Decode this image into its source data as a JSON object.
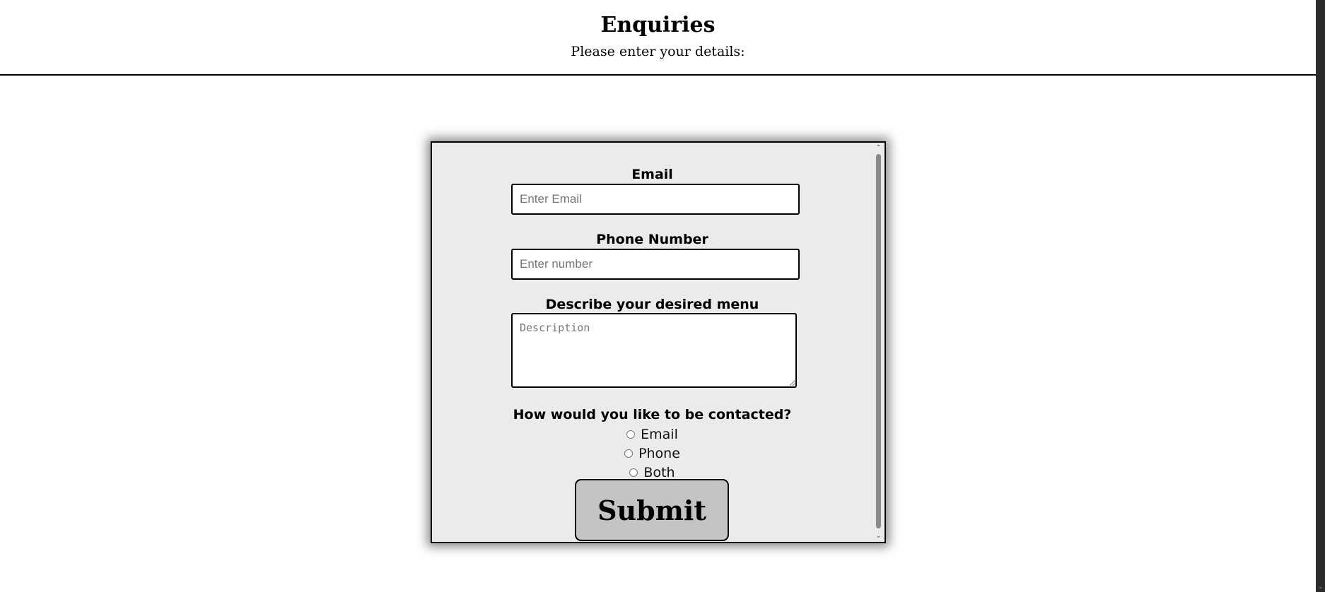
{
  "header": {
    "title": "Enquiries",
    "subtitle": "Please enter your details:"
  },
  "form": {
    "email_label": "Email",
    "email_placeholder": "Enter Email",
    "phone_label": "Phone Number",
    "phone_placeholder": "Enter number",
    "menu_label": "Describe your desired menu",
    "menu_placeholder": "Description",
    "contact_question": "How would you like to be contacted?",
    "contact_options": [
      "Email",
      "Phone",
      "Both"
    ],
    "submit_label": "Submit"
  },
  "icons": {
    "scroll_up": "chevron-up-icon",
    "scroll_down": "chevron-down-icon"
  },
  "colors": {
    "form_background": "#ebebeb",
    "submit_background": "#c4c4c4"
  }
}
